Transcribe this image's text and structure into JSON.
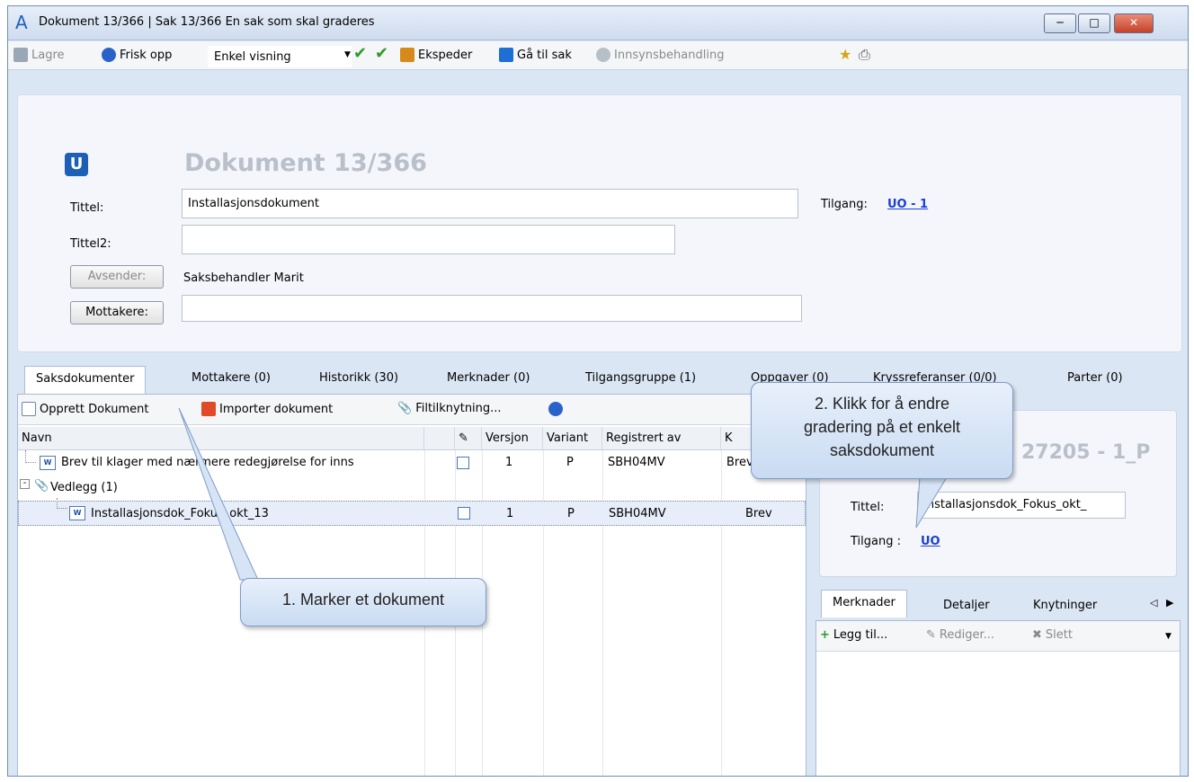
{
  "window": {
    "title": "Dokument 13/366 | Sak 13/366 En sak som skal graderes",
    "app_icon": "A"
  },
  "toolbar": {
    "save": "Lagre",
    "refresh": "Frisk opp",
    "view_mode": "Enkel visning",
    "dispatch": "Ekspeder",
    "goto_case": "Gå til sak",
    "access_review": "Innsynsbehandling"
  },
  "document": {
    "type_badge": "U",
    "heading": "Dokument 13/366",
    "title_label": "Tittel:",
    "title_value": "Installasjonsdokument",
    "title2_label": "Tittel2:",
    "title2_value": "",
    "sender_button": "Avsender:",
    "sender_value": "Saksbehandler Marit",
    "recipients_button": "Mottakere:",
    "recipients_value": "",
    "access_label": "Tilgang:",
    "access_value": "UO - 1"
  },
  "tabs": [
    "Saksdokumenter",
    "Mottakere (0)",
    "Historikk (30)",
    "Merknader (0)",
    "Tilgangsgruppe (1)",
    "Oppgaver (0)",
    "Kryssreferanser (0/0)",
    "Parter (0)"
  ],
  "doc_toolbar": {
    "create": "Opprett Dokument",
    "import": "Importer dokument",
    "file_link": "Filtilknytning..."
  },
  "grid": {
    "columns": [
      "Navn",
      "",
      "Versjon",
      "Variant",
      "Registrert av",
      "K"
    ],
    "rows": [
      {
        "name": "Brev til klager med nærmere redegjørelse for inns",
        "version": "1",
        "variant": "P",
        "registered_by": "SBH04MV",
        "k": "Brev"
      },
      {
        "name": "Vedlegg (1)"
      },
      {
        "name": "Installasjonsdok_Fokus_okt_13",
        "version": "1",
        "variant": "P",
        "registered_by": "SBH04MV",
        "k": "Brev"
      }
    ]
  },
  "side_info": {
    "heading": "27205 - 1_P",
    "title_label": "Tittel:",
    "title_value": "Installasjonsdok_Fokus_okt_",
    "access_label": "Tilgang :",
    "access_value": "UO"
  },
  "side_tabs": [
    "Merknader",
    "Detaljer",
    "Knytninger"
  ],
  "side_toolbar": {
    "add": "Legg til...",
    "edit": "Rediger...",
    "delete": "Slett"
  },
  "callouts": {
    "step1": "1. Marker et dokument",
    "step2_line1": "2. Klikk for å endre",
    "step2_line2": "gradering på et enkelt",
    "step2_line3": "saksdokument"
  }
}
